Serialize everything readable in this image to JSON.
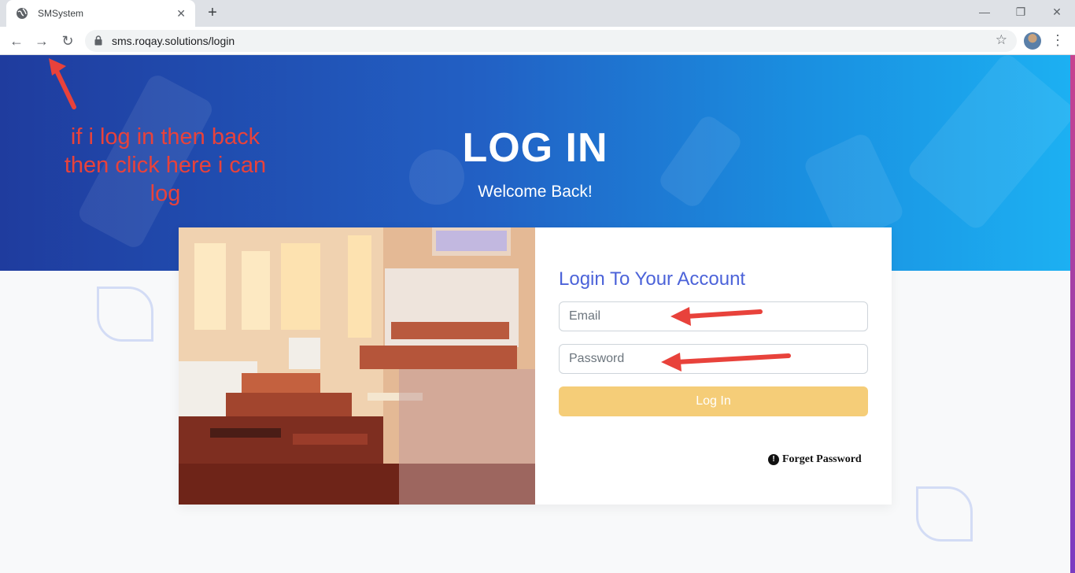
{
  "browser": {
    "tab_title": "SMSystem",
    "tab_close": "✕",
    "new_tab": "+",
    "url": "sms.roqay.solutions/login",
    "window_controls": {
      "minimize": "—",
      "restore": "❐",
      "close": "✕"
    },
    "nav": {
      "back": "←",
      "forward": "→",
      "reload": "↻",
      "star": "☆",
      "menu": "⋮"
    }
  },
  "hero": {
    "title": "LOG IN",
    "subtitle": "Welcome Back!"
  },
  "annotation": {
    "text": "if i log in then back then click here i can log",
    "color": "#e8423b"
  },
  "login": {
    "heading": "Login To Your Account",
    "email_placeholder": "Email",
    "password_placeholder": "Password",
    "submit_label": "Log In",
    "forget_label": "Forget Password"
  },
  "colors": {
    "accent": "#4c63d9",
    "button": "#f5cd78",
    "hero_start": "#1f3c9e",
    "hero_end": "#1cb0f2"
  },
  "icons": [
    "globe-icon",
    "lock-icon",
    "star-icon",
    "avatar",
    "info-icon"
  ]
}
